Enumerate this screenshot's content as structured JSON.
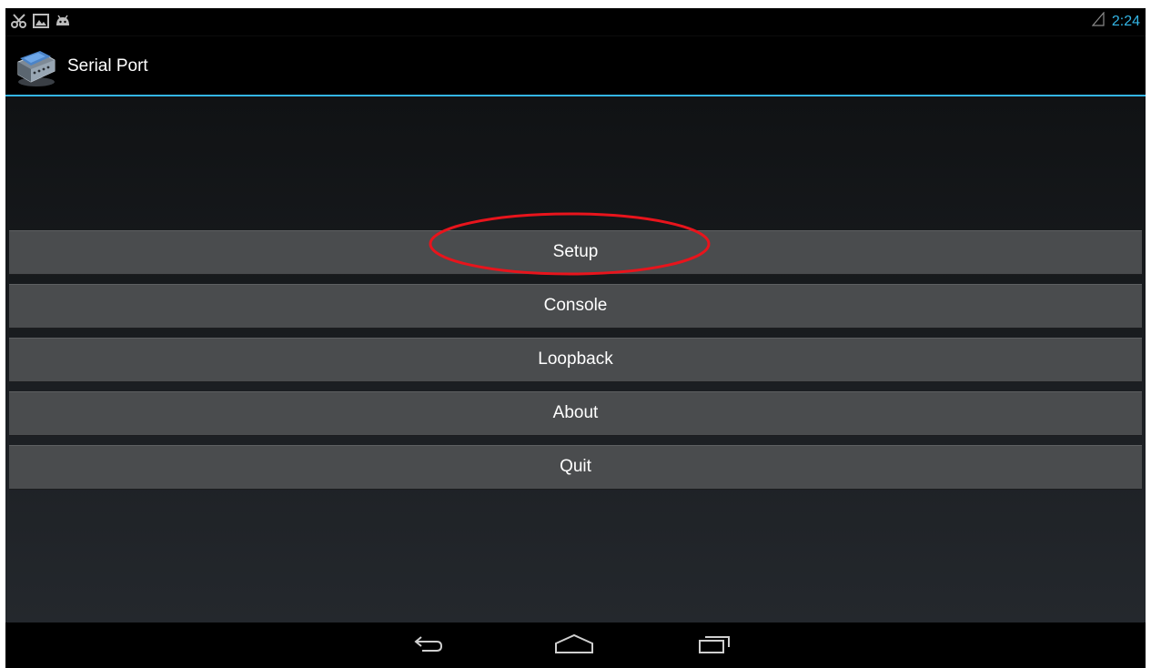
{
  "status_bar": {
    "left_icons": [
      "scissors-icon",
      "image-icon",
      "android-icon"
    ],
    "signal_icon": "signal-icon",
    "time": "2:24",
    "accent_color": "#33b5e5"
  },
  "action_bar": {
    "app_icon": "serial-port-icon",
    "title": "Serial Port"
  },
  "menu": {
    "buttons": [
      "Setup",
      "Console",
      "Loopback",
      "About",
      "Quit"
    ],
    "highlighted": "Setup",
    "highlight_color": "#e8141c"
  },
  "nav_bar": {
    "buttons": [
      "back-icon",
      "home-icon",
      "recent-apps-icon"
    ]
  }
}
